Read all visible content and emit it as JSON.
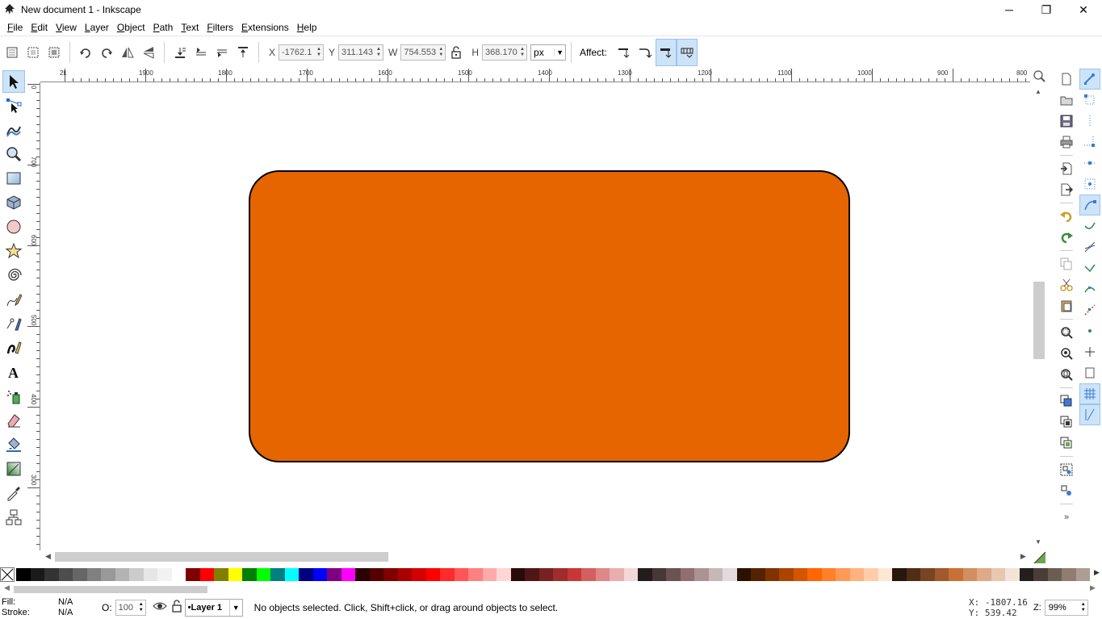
{
  "window": {
    "title": "New document 1 - Inkscape",
    "minimize": "─",
    "maximize": "❐",
    "close": "✕"
  },
  "menu": [
    "File",
    "Edit",
    "View",
    "Layer",
    "Object",
    "Path",
    "Text",
    "Filters",
    "Extensions",
    "Help"
  ],
  "controls": {
    "x_label": "X",
    "x_value": "-1762.1",
    "y_label": "Y",
    "y_value": "311.143",
    "w_label": "W",
    "w_value": "754.553",
    "h_label": "H",
    "h_value": "368.170",
    "unit": "px",
    "affect_label": "Affect:"
  },
  "rulers": {
    "horizontal": [
      "2k",
      "1900",
      "1800",
      "1700",
      "1600",
      "1500",
      "1400",
      "1300",
      "1200",
      "1100",
      "1000",
      "900",
      "800"
    ],
    "vertical": [
      "0",
      "700",
      "600",
      "500",
      "400",
      "300"
    ]
  },
  "canvas": {
    "shape_fill": "#e66500",
    "shape_stroke": "#000000"
  },
  "palette": [
    "#000000",
    "#1a1a1a",
    "#333333",
    "#4d4d4d",
    "#666666",
    "#808080",
    "#999999",
    "#b3b3b3",
    "#cccccc",
    "#e6e6e6",
    "#f2f2f2",
    "#ffffff",
    "#800000",
    "#ff0000",
    "#808000",
    "#ffff00",
    "#008000",
    "#00ff00",
    "#008080",
    "#00ffff",
    "#000080",
    "#0000ff",
    "#800080",
    "#ff00ff",
    "#2b0000",
    "#550000",
    "#800000",
    "#aa0000",
    "#d40000",
    "#ff0000",
    "#ff2a2a",
    "#ff5555",
    "#ff8080",
    "#ffaaaa",
    "#ffd5d5",
    "#280b0b",
    "#501616",
    "#782121",
    "#a02c2c",
    "#c83737",
    "#d35f5f",
    "#de8787",
    "#e9afaf",
    "#f4d7d7",
    "#241c1c",
    "#483737",
    "#6c5353",
    "#916f6f",
    "#ac9393",
    "#c8b7b7",
    "#e3dbdb",
    "#2b1100",
    "#552200",
    "#803300",
    "#aa4400",
    "#d45500",
    "#ff6600",
    "#ff7f2a",
    "#ff9955",
    "#ffb380",
    "#ffccaa",
    "#ffe6d5",
    "#28170b",
    "#502d16",
    "#784421",
    "#a05a2c",
    "#c87137",
    "#d38d5f",
    "#deaa87",
    "#e9c6af",
    "#f4e3d7",
    "#241f1c",
    "#483e37",
    "#6c5d53",
    "#917c6f",
    "#ac9d93"
  ],
  "status": {
    "fill_label": "Fill:",
    "fill_value": "N/A",
    "stroke_label": "Stroke:",
    "stroke_value": "N/A",
    "opacity_label": "O:",
    "opacity_value": "100",
    "layer": "•Layer 1",
    "message": "No objects selected. Click, Shift+click, or drag around objects to select.",
    "cursor_x": "X: -1807.16",
    "cursor_y": "Y:   539.42",
    "zoom_label": "Z:",
    "zoom_value": "99%"
  }
}
